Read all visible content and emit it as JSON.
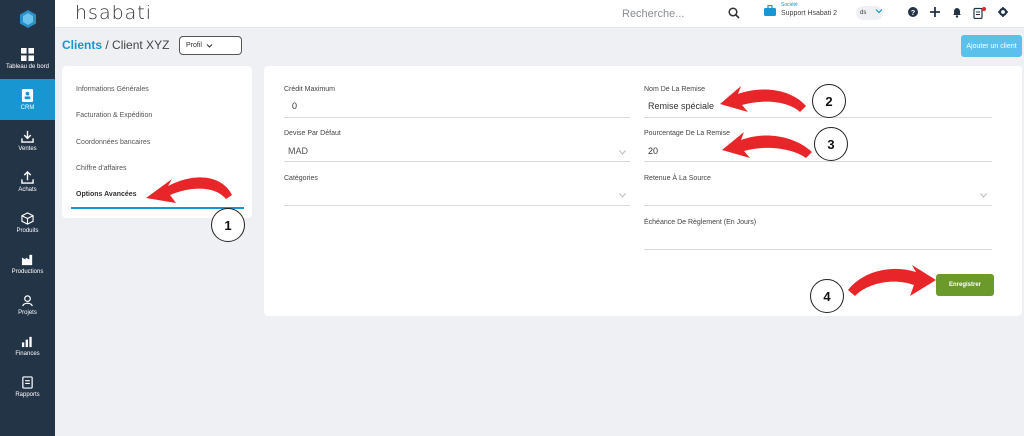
{
  "sidebar": {
    "items": [
      {
        "label": "Tableau de bord",
        "icon": "dashboard-icon"
      },
      {
        "label": "CRM",
        "icon": "crm-icon",
        "active": true
      },
      {
        "label": "Ventes",
        "icon": "download-icon"
      },
      {
        "label": "Achats",
        "icon": "upload-icon"
      },
      {
        "label": "Produits",
        "icon": "box-icon"
      },
      {
        "label": "Productions",
        "icon": "factory-icon"
      },
      {
        "label": "Projets",
        "icon": "projects-icon"
      },
      {
        "label": "Finances",
        "icon": "chart-icon"
      },
      {
        "label": "Rapports",
        "icon": "reports-icon"
      }
    ]
  },
  "topbar": {
    "brand": "hsabati",
    "search_placeholder": "Recherche...",
    "company_label": "Société",
    "company_name": "Support Hsabati 2",
    "user_initials": "ds"
  },
  "header": {
    "breadcrumb_root": "Clients",
    "breadcrumb_sep": "/",
    "breadcrumb_client": "Client XYZ",
    "profil_label": "Profil",
    "add_client_label": "Ajouter un client"
  },
  "menu": {
    "items": [
      {
        "label": "Informations Générales"
      },
      {
        "label": "Facturation & Expédition"
      },
      {
        "label": "Coordonnées bancaires"
      },
      {
        "label": "Chiffre d'affaires"
      },
      {
        "label": "Options Avancées",
        "active": true
      }
    ]
  },
  "form": {
    "credit_max": {
      "label": "Crédit Maximum",
      "value": "0"
    },
    "devise": {
      "label": "Devise Par Défaut",
      "value": "MAD"
    },
    "categories": {
      "label": "Catégories",
      "value": ""
    },
    "nom_remise": {
      "label": "Nom De La Remise",
      "value": "Remise spéciale"
    },
    "pourcentage_remise": {
      "label": "Pourcentage De La Remise",
      "value": "20"
    },
    "retenue": {
      "label": "Retenue À La Source",
      "value": ""
    },
    "echeance": {
      "label": "Échéance De Règlement (En Jours)",
      "value": ""
    },
    "save_label": "Enregistrer"
  },
  "annotations": {
    "steps": [
      "1",
      "2",
      "3",
      "4"
    ],
    "arrow_color": "#e8262a"
  },
  "colors": {
    "sidebar_bg": "#243447",
    "accent": "#1796d2",
    "save_button": "#6b9a2b",
    "add_button": "#5bc0ea"
  }
}
